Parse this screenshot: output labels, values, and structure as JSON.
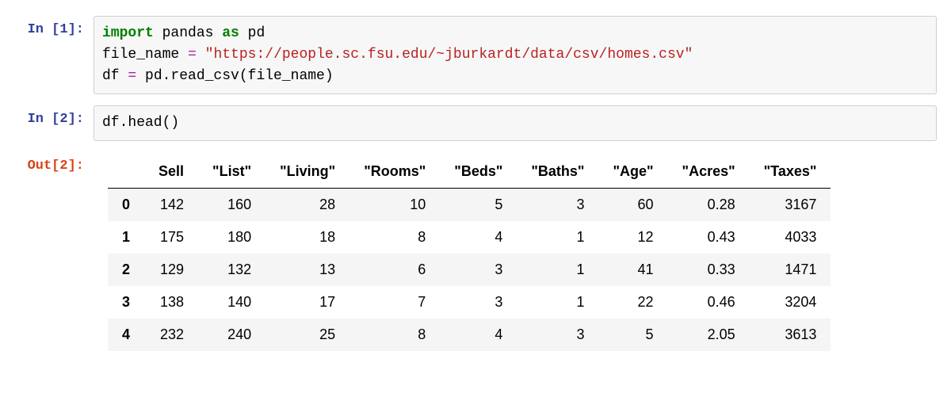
{
  "cells": {
    "in1": {
      "prompt": "In [1]:",
      "code_tokens": {
        "import": "import",
        "lib": " pandas ",
        "as": "as",
        "alias": " pd",
        "line2a": "file_name ",
        "eq1": "=",
        "line2b": " ",
        "str": "\"https://people.sc.fsu.edu/~jburkardt/data/csv/homes.csv\"",
        "line3a": "df ",
        "eq2": "=",
        "line3b": " pd.read_csv(file_name)"
      }
    },
    "in2": {
      "prompt": "In [2]:",
      "code": "df.head()"
    },
    "out2": {
      "prompt": "Out[2]:",
      "columns": [
        "Sell",
        "\"List\"",
        "\"Living\"",
        "\"Rooms\"",
        "\"Beds\"",
        "\"Baths\"",
        "\"Age\"",
        "\"Acres\"",
        "\"Taxes\""
      ],
      "index": [
        "0",
        "1",
        "2",
        "3",
        "4"
      ],
      "rows": [
        [
          "142",
          "160",
          "28",
          "10",
          "5",
          "3",
          "60",
          "0.28",
          "3167"
        ],
        [
          "175",
          "180",
          "18",
          "8",
          "4",
          "1",
          "12",
          "0.43",
          "4033"
        ],
        [
          "129",
          "132",
          "13",
          "6",
          "3",
          "1",
          "41",
          "0.33",
          "1471"
        ],
        [
          "138",
          "140",
          "17",
          "7",
          "3",
          "1",
          "22",
          "0.46",
          "3204"
        ],
        [
          "232",
          "240",
          "25",
          "8",
          "4",
          "3",
          "5",
          "2.05",
          "3613"
        ]
      ]
    }
  }
}
